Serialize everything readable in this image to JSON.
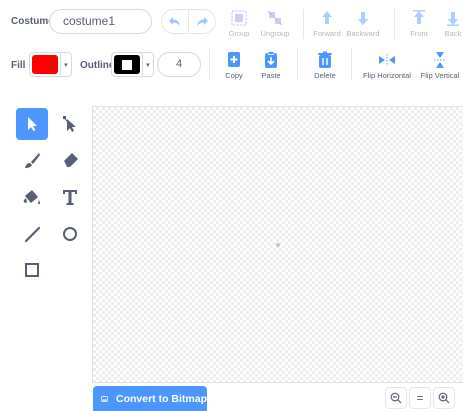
{
  "costume": {
    "label": "Costume",
    "name_value": "costume1"
  },
  "toolbar": {
    "group_label": "Group",
    "ungroup_label": "Ungroup",
    "forward_label": "Forward",
    "backward_label": "Backward",
    "front_label": "Front",
    "back_label": "Back",
    "copy_label": "Copy",
    "paste_label": "Paste",
    "delete_label": "Delete",
    "flip_h_label": "Flip Horizontal",
    "flip_v_label": "Flip Vertical"
  },
  "fill": {
    "label": "Fill",
    "color": "#ff0000"
  },
  "outline": {
    "label": "Outline",
    "color": "#000000",
    "width_value": "4"
  },
  "tools": [
    "select-tool",
    "reshape-tool",
    "brush-tool",
    "eraser-tool",
    "fill-tool",
    "text-tool",
    "line-tool",
    "circle-tool",
    "rectangle-tool"
  ],
  "selected_tool": "select-tool",
  "convert": {
    "label": "Convert to Bitmap"
  },
  "zoom": {
    "reset_label": "="
  },
  "colors": {
    "accent": "#4c97ff",
    "icon_blue": "#4c97ff",
    "text": "#575e75"
  }
}
